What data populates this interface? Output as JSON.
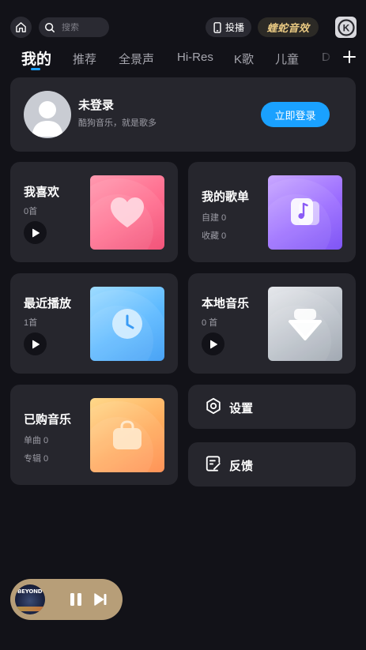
{
  "header": {
    "search_placeholder": "搜索",
    "cast_label": "投播",
    "effect_label": "蝰蛇音效",
    "k_label": "K"
  },
  "tabs": [
    {
      "label": "我的",
      "active": true
    },
    {
      "label": "推荐"
    },
    {
      "label": "全景声"
    },
    {
      "label": "Hi-Res"
    },
    {
      "label": "K歌"
    },
    {
      "label": "儿童"
    },
    {
      "label": "D"
    }
  ],
  "login": {
    "title": "未登录",
    "subtitle": "酷狗音乐，就是歌多",
    "button": "立即登录"
  },
  "cards": {
    "favorites": {
      "title": "我喜欢",
      "count": "0首",
      "icon": "heart-icon"
    },
    "playlists": {
      "title": "我的歌单",
      "created": "自建 0",
      "collected": "收藏 0",
      "icon": "playlist-icon"
    },
    "recent": {
      "title": "最近播放",
      "count": "1首",
      "icon": "clock-icon"
    },
    "local": {
      "title": "本地音乐",
      "count": "0 首",
      "icon": "download-icon"
    },
    "purchased": {
      "title": "已购音乐",
      "singles": "单曲 0",
      "albums": "专辑 0",
      "icon": "bag-icon"
    }
  },
  "settings": {
    "label": "设置",
    "icon": "gear-icon"
  },
  "feedback": {
    "label": "反馈",
    "icon": "feedback-icon"
  },
  "player": {
    "cover_text": "BEYOND"
  },
  "colors": {
    "background": "#121218",
    "card": "#26262d",
    "accent": "#1aa1ff",
    "player": "#b79e78"
  }
}
